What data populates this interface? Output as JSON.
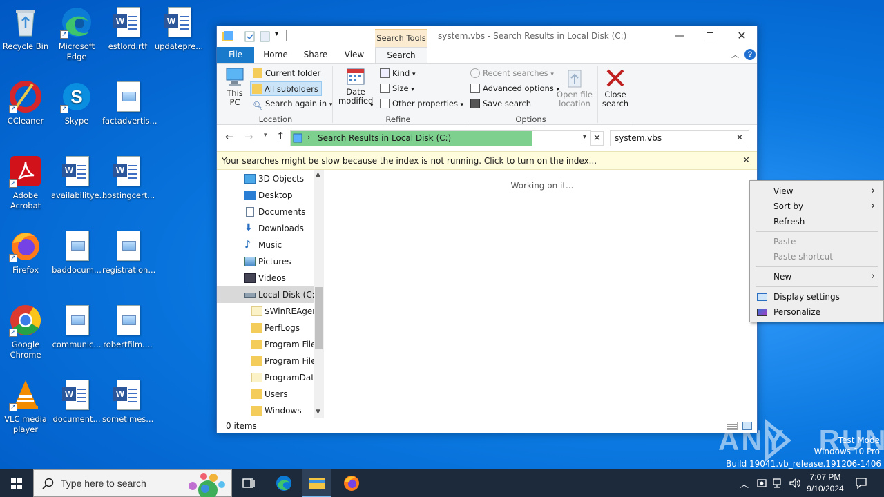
{
  "desktop": {
    "icons": [
      {
        "label": "Recycle Bin"
      },
      {
        "label": "Microsoft Edge"
      },
      {
        "label": "estlord.rtf"
      },
      {
        "label": "updatepre..."
      },
      {
        "label": "CCleaner"
      },
      {
        "label": "Skype"
      },
      {
        "label": "factadvertis..."
      },
      {
        "label": "Adobe Acrobat"
      },
      {
        "label": "availabilitye..."
      },
      {
        "label": "hostingcert..."
      },
      {
        "label": "Firefox"
      },
      {
        "label": "baddocum..."
      },
      {
        "label": "registration..."
      },
      {
        "label": "Google Chrome"
      },
      {
        "label": "communic..."
      },
      {
        "label": "robertfilm...."
      },
      {
        "label": "VLC media player"
      },
      {
        "label": "document..."
      },
      {
        "label": "sometimes..."
      }
    ]
  },
  "explorer": {
    "context_tab": "Search Tools",
    "title": "system.vbs - Search Results in Local Disk (C:)",
    "tabs": {
      "file": "File",
      "home": "Home",
      "share": "Share",
      "view": "View",
      "search": "Search"
    },
    "ribbon": {
      "this_pc": "This PC",
      "current_folder": "Current folder",
      "all_subfolders": "All subfolders",
      "search_again": "Search again in",
      "location_label": "Location",
      "date_modified": "Date modified",
      "kind": "Kind",
      "size": "Size",
      "other_properties": "Other properties",
      "refine_label": "Refine",
      "recent_searches": "Recent searches",
      "advanced_options": "Advanced options",
      "save_search": "Save search",
      "open_file_location": "Open file location",
      "options_label": "Options",
      "close_search": "Close search"
    },
    "address": "Search Results in Local Disk (C:)",
    "search_value": "system.vbs",
    "banner": "Your searches might be slow because the index is not running.  Click to turn on the index...",
    "working": "Working on it...",
    "nav": [
      "3D Objects",
      "Desktop",
      "Documents",
      "Downloads",
      "Music",
      "Pictures",
      "Videos",
      "Local Disk (C:)",
      "$WinREAgent",
      "PerfLogs",
      "Program Files",
      "Program Files",
      "ProgramData",
      "Users",
      "Windows"
    ],
    "status": "0 items"
  },
  "context_menu": {
    "view": "View",
    "sort_by": "Sort by",
    "refresh": "Refresh",
    "paste": "Paste",
    "paste_shortcut": "Paste shortcut",
    "new": "New",
    "display_settings": "Display settings",
    "personalize": "Personalize"
  },
  "taskbar": {
    "search_placeholder": "Type here to search",
    "time": "7:07 PM",
    "date": "9/10/2024"
  },
  "watermark": {
    "brand": "ANY RUN",
    "line1": "Test Mode",
    "line2": "Windows 10 Pro",
    "line3": "Build 19041.vb_release.191206-1406"
  },
  "colors": {
    "accent": "#1979ca",
    "address_highlight": "#7ed08f",
    "banner_bg": "#fffbdd",
    "taskbar": "#1c2a3c"
  }
}
